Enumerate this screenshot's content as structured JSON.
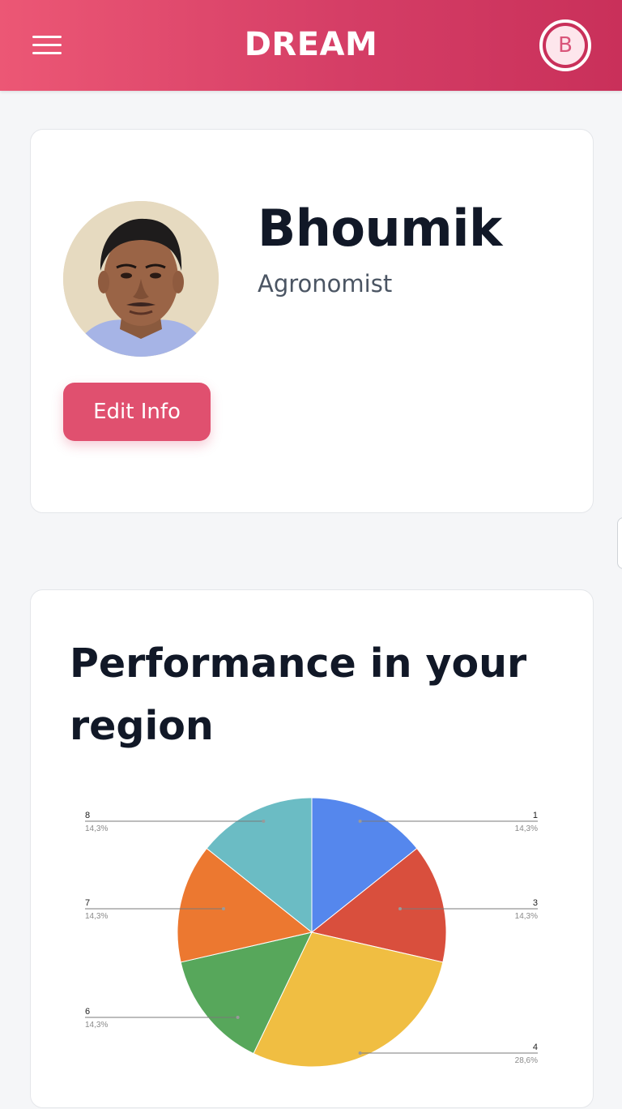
{
  "header": {
    "title": "DREAM",
    "avatar_initial": "B",
    "brand_color": "#e0506f"
  },
  "icons": {
    "menu": "hamburger-menu-icon",
    "avatar": "user-avatar-icon"
  },
  "profile": {
    "name": "Bhoumik",
    "role": "Agronomist",
    "edit_label": "Edit Info"
  },
  "performance": {
    "title": "Performance in your region"
  },
  "chart_data": {
    "type": "pie",
    "title": "",
    "slices": [
      {
        "label": "1",
        "value": 1,
        "percent": "14,3%",
        "color": "#5587ed"
      },
      {
        "label": "3",
        "value": 1,
        "percent": "14,3%",
        "color": "#d94f3d"
      },
      {
        "label": "4",
        "value": 2,
        "percent": "28,6%",
        "color": "#f0be42"
      },
      {
        "label": "6",
        "value": 1,
        "percent": "14,3%",
        "color": "#57a75b"
      },
      {
        "label": "7",
        "value": 1,
        "percent": "14,3%",
        "color": "#ec7830"
      },
      {
        "label": "8",
        "value": 1,
        "percent": "14,3%",
        "color": "#6bbcc4"
      }
    ]
  }
}
